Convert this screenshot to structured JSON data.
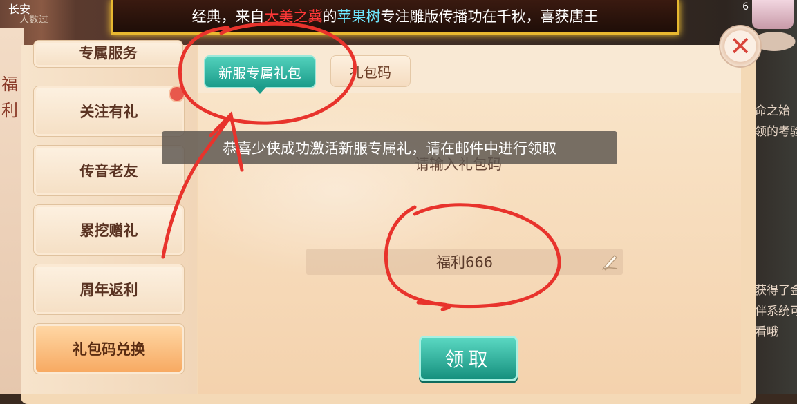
{
  "background": {
    "top_left_tag": "长安",
    "top_left_sub": "人数过",
    "left_glyphs": [
      "福",
      "利"
    ],
    "top_right_number": "6",
    "right_texts": [
      "天命之始",
      "完领的考验",
      "快获得了金",
      "伙伴系统可",
      "查看哦"
    ]
  },
  "marquee": {
    "prefix": "经典，来自",
    "highlight_red": "大美之冀",
    "mid": "的",
    "highlight_cyan": "苹果树",
    "suffix": "专注雕版传播功在千秋，喜获唐王"
  },
  "sidebar": {
    "items": [
      {
        "label": "专属服务"
      },
      {
        "label": "关注有礼"
      },
      {
        "label": "传音老友"
      },
      {
        "label": "累挖赠礼"
      },
      {
        "label": "周年返利"
      },
      {
        "label": "礼包码兑换"
      }
    ]
  },
  "tabs": [
    {
      "label": "新服专属礼包",
      "active": true
    },
    {
      "label": "礼包码",
      "active": false
    }
  ],
  "toast": "恭喜少侠成功激活新服专属礼，请在邮件中进行领取",
  "prompt": "请输入礼包码",
  "code_input": {
    "value": "福利666",
    "icon": "edit-icon"
  },
  "claim_button": "领取",
  "close_icon": "close-icon",
  "colors": {
    "accent_teal": "#1b9c8a",
    "annotation_red": "#e8332c",
    "marquee_border": "#e8b830"
  }
}
